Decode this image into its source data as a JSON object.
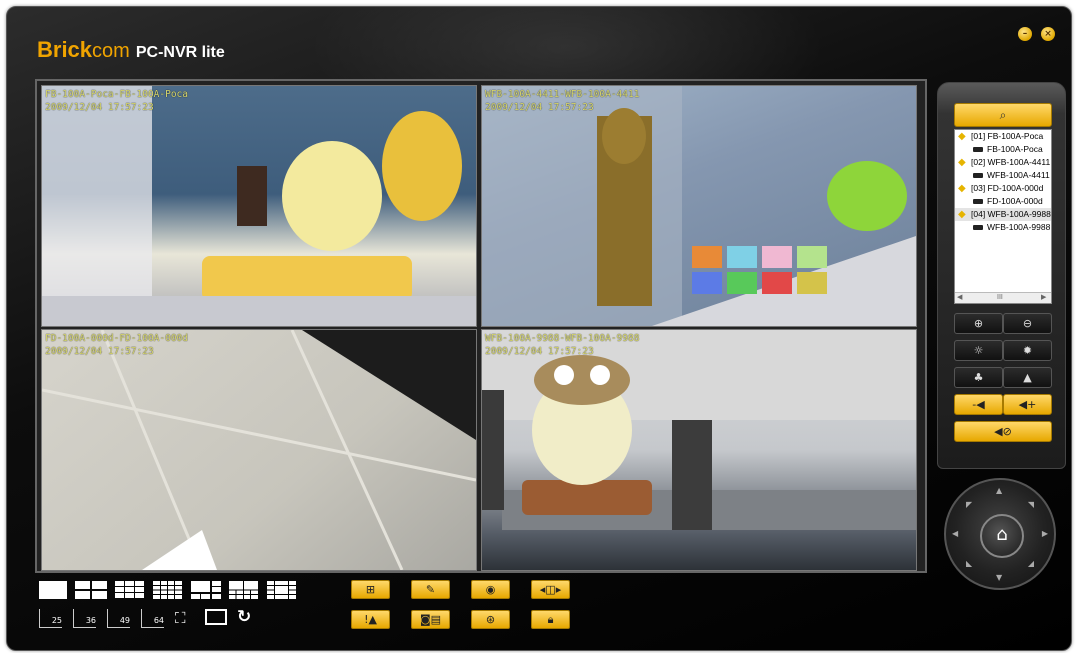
{
  "app": {
    "brand_part1": "Brick",
    "brand_part2": "com",
    "brand_product": "PC-NVR lite",
    "minimize_icon": "minimize-icon",
    "close_icon": "close-icon"
  },
  "cameras": [
    {
      "title": "FB-100A-Poca-FB-100A-Poca",
      "timestamp": "2009/12/04 17:57:23"
    },
    {
      "title": "WFB-100A-4411-WFB-100A-4411",
      "timestamp": "2009/12/04 17:57:23"
    },
    {
      "title": "FD-100A-000d-FD-100A-000d",
      "timestamp": "2009/12/04 17:57:23"
    },
    {
      "title": "WFB-100A-9988-WFB-100A-9988",
      "timestamp": "2009/12/04 17:57:23"
    }
  ],
  "device_tree": {
    "search_icon": "search-icon",
    "items": [
      {
        "group": "[01] FB-100A-Poca",
        "camera": "FB-100A-Poca"
      },
      {
        "group": "[02] WFB-100A-4411",
        "camera": "WFB-100A-4411"
      },
      {
        "group": "[03] FD-100A-000d",
        "camera": "FD-100A-000d"
      },
      {
        "group": "[04] WFB-100A-9988",
        "camera": "WFB-100A-9988"
      }
    ],
    "scroll_mid": "III"
  },
  "controls": {
    "zoom_in": "zoom-in-icon",
    "zoom_out": "zoom-out-icon",
    "brightness_down": "brightness-down-icon",
    "brightness_up": "brightness-up-icon",
    "focus_near": "focus-near-icon",
    "focus_far": "focus-far-icon",
    "volume_down": "volume-down-icon",
    "volume_up": "volume-up-icon",
    "mute": "mute-icon"
  },
  "layout_numbers": [
    "25",
    "36",
    "49",
    "64"
  ],
  "colors": {
    "accent": "#e7a800",
    "brand": "#f0a400",
    "background": "#000000"
  }
}
